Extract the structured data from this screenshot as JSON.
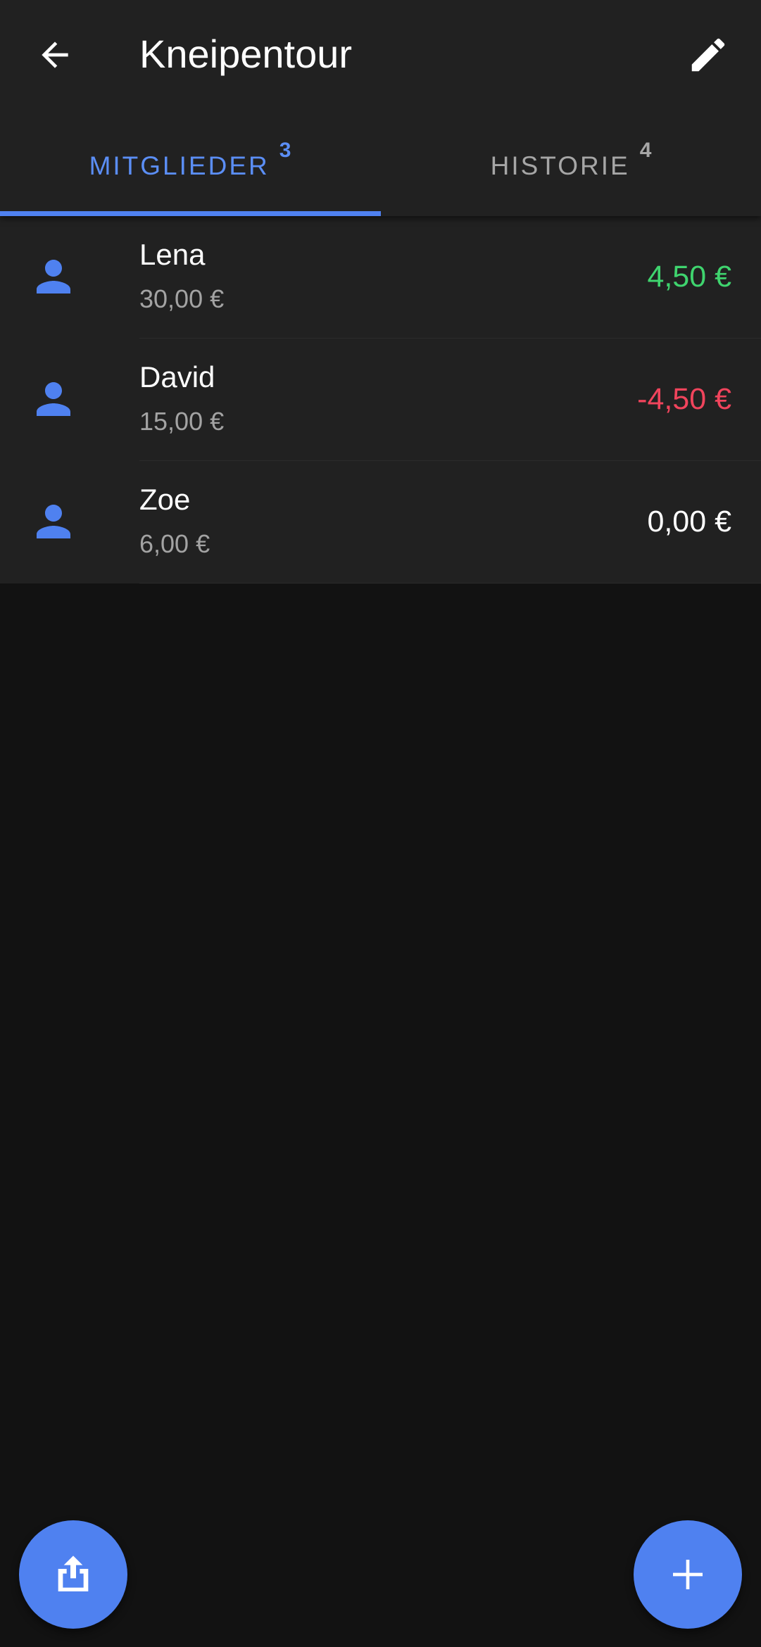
{
  "appbar": {
    "title": "Kneipentour",
    "back_icon": "arrow-left-icon",
    "edit_icon": "pencil-icon"
  },
  "tabs": [
    {
      "label": "MITGLIEDER",
      "count": "3",
      "active": true
    },
    {
      "label": "HISTORIE",
      "count": "4",
      "active": false
    }
  ],
  "members": [
    {
      "name": "Lena",
      "spent": "30,00 €",
      "balance": "4,50 €",
      "balance_color": "#3fd46e"
    },
    {
      "name": "David",
      "spent": "15,00 €",
      "balance": "-4,50 €",
      "balance_color": "#f0445c"
    },
    {
      "name": "Zoe",
      "spent": "6,00 €",
      "balance": "0,00 €",
      "balance_color": "#ffffff"
    }
  ],
  "fabs": {
    "share_icon": "share-export-icon",
    "add_icon": "plus-icon"
  },
  "colors": {
    "accent": "#4f81f0",
    "appbar_bg": "#212121",
    "page_bg": "#121212",
    "positive": "#3fd46e",
    "negative": "#f0445c"
  }
}
